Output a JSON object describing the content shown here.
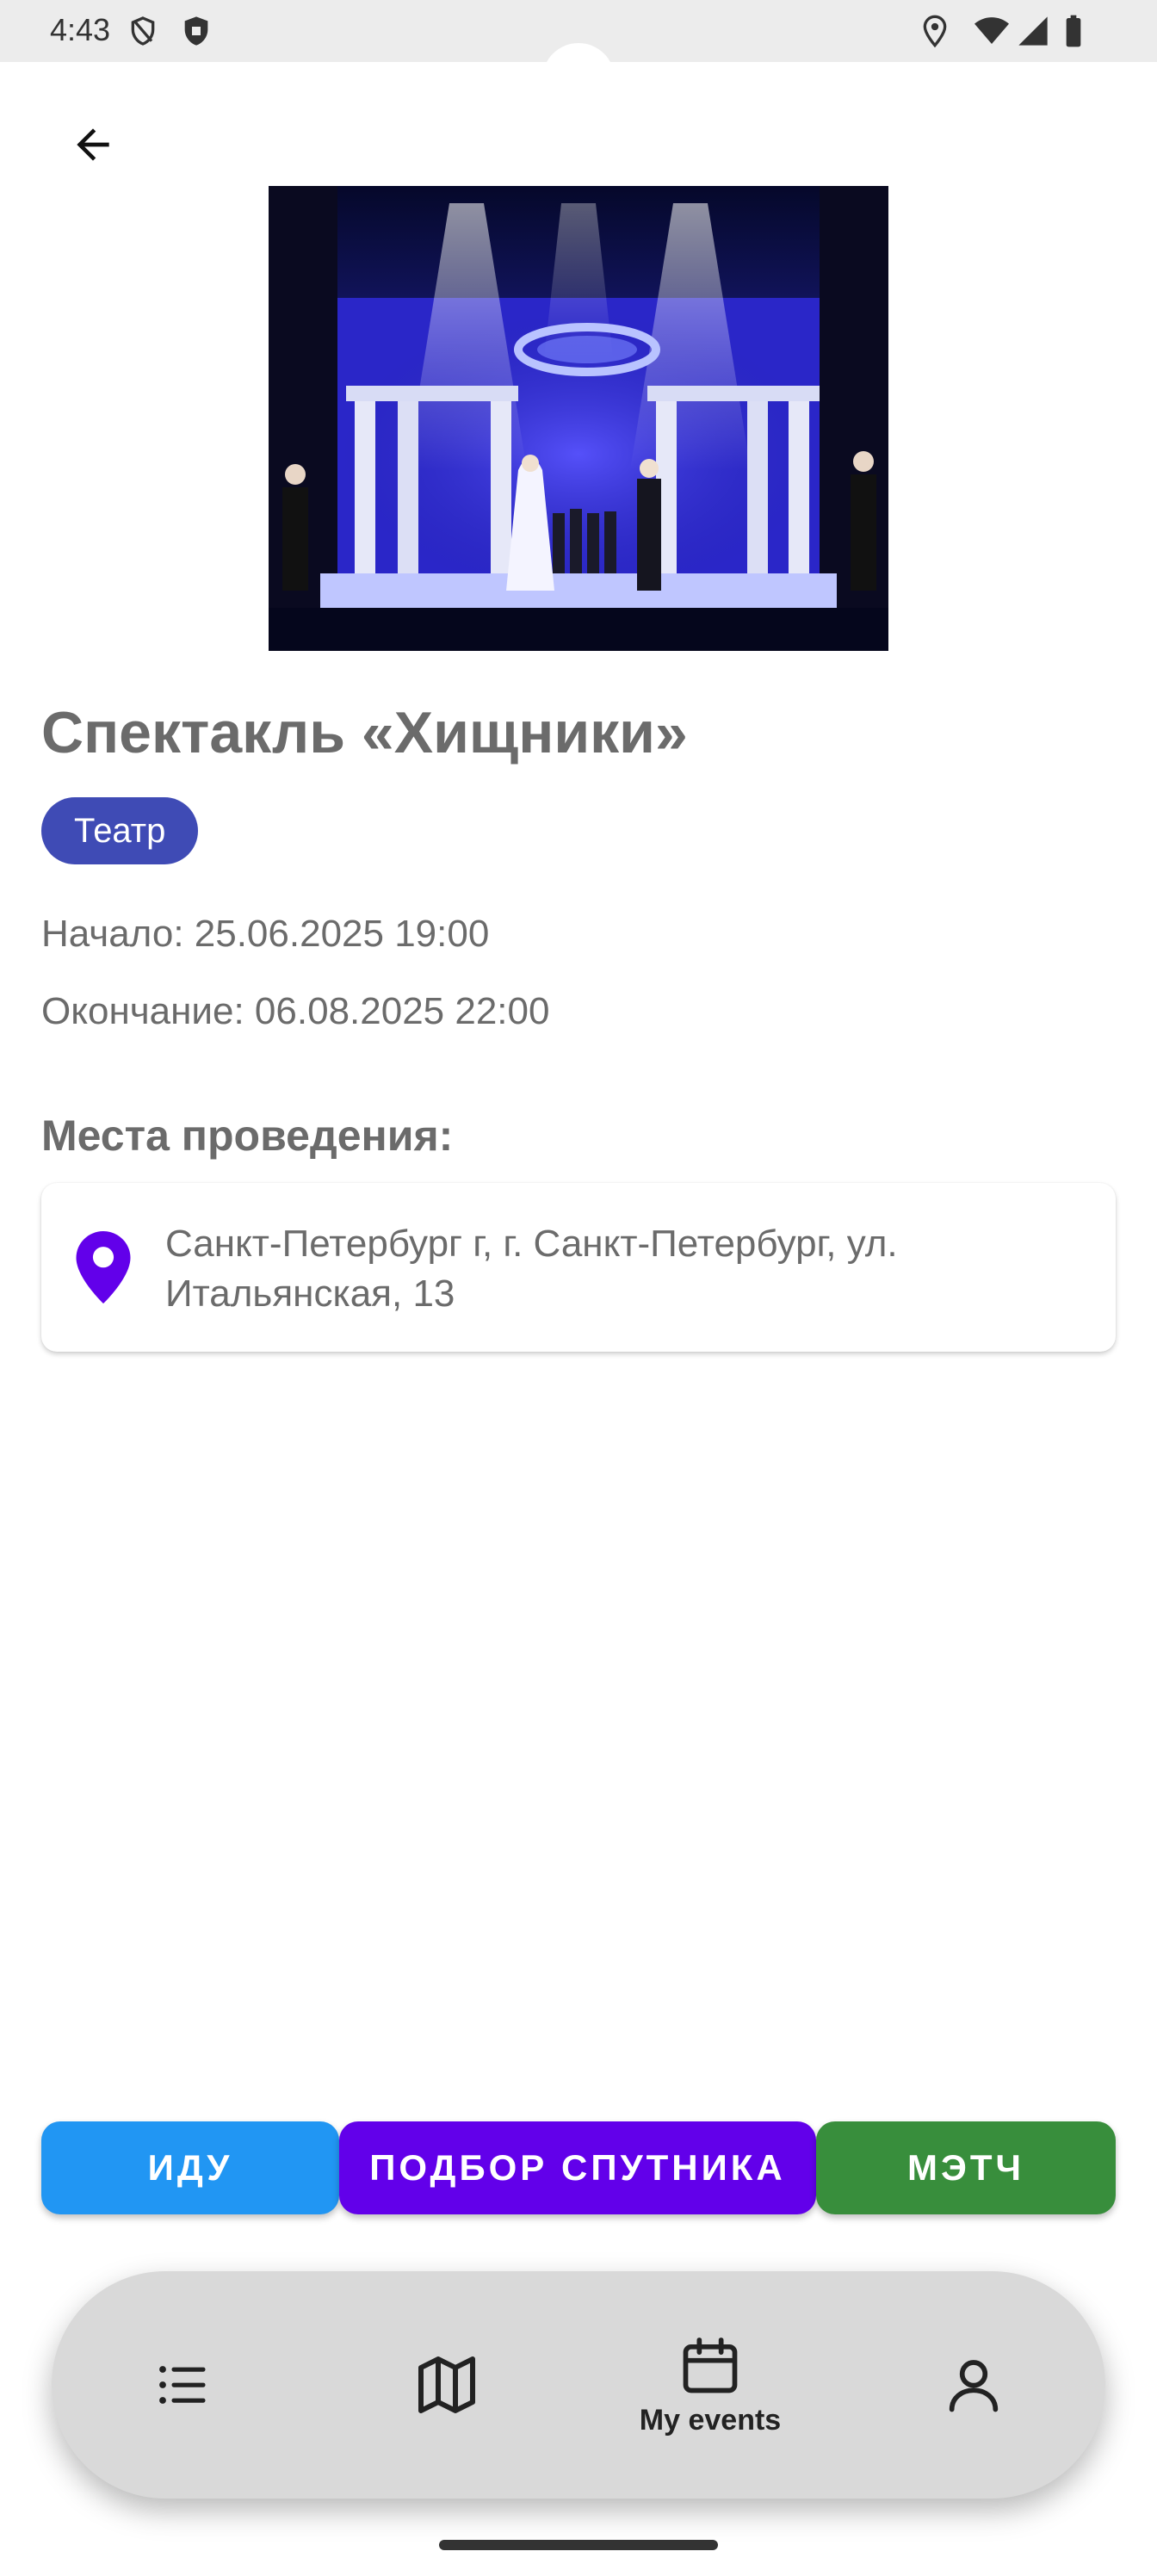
{
  "status_bar": {
    "time": "4:43"
  },
  "event": {
    "title": "Спектакль «Хищники»",
    "category": "Театр",
    "start": "Начало: 25.06.2025 19:00",
    "end": "Окончание: 06.08.2025 22:00"
  },
  "venues": {
    "heading": "Места проведения:",
    "items": [
      {
        "address": "Санкт-Петербург г, г. Санкт-Петербург, ул. Итальянская, 13"
      }
    ]
  },
  "actions": {
    "go_label": "ИДУ",
    "companion_label": "ПОДБОР СПУТНИКА",
    "match_label": "МЭТЧ"
  },
  "nav": {
    "active_label": "My events"
  },
  "colors": {
    "chip": "#3f4bb5",
    "pin": "#6200ea",
    "go": "#2196f3",
    "companion": "#6200ea",
    "match": "#388e3c"
  },
  "icons": [
    "back-arrow-icon",
    "location-pin-icon",
    "list-icon",
    "map-icon",
    "calendar-icon",
    "person-icon"
  ]
}
